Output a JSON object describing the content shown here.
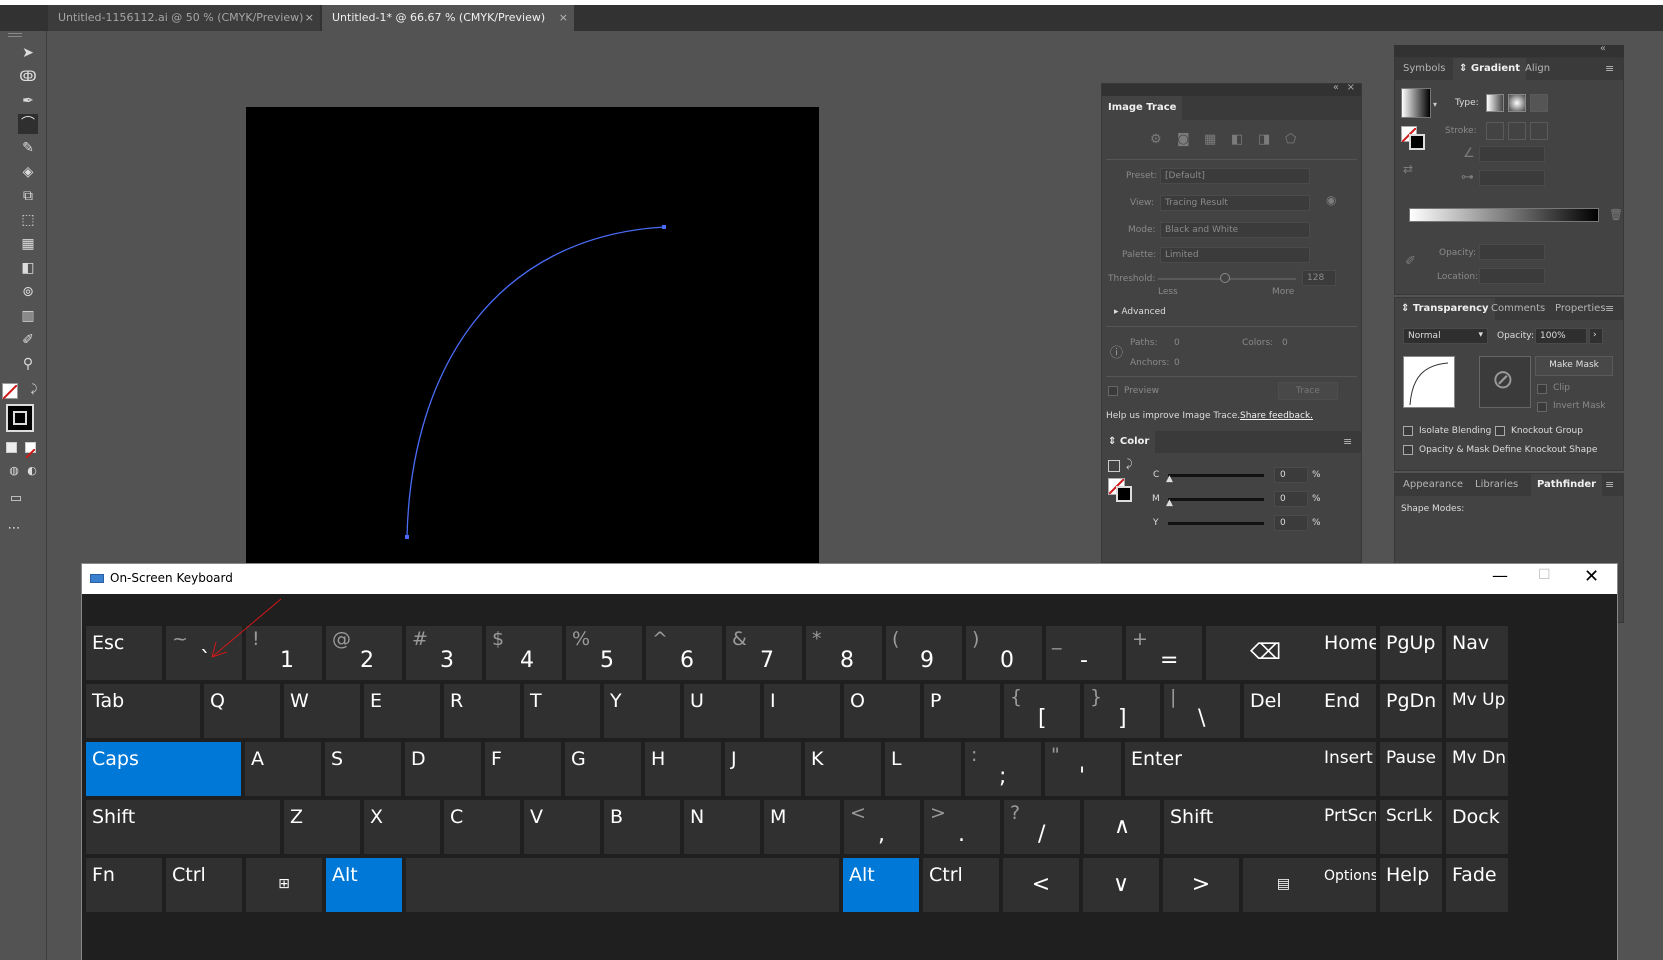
{
  "tabs": [
    {
      "label": "Untitled-1156112.ai @ 50 % (CMYK/Preview)",
      "close": "×"
    },
    {
      "label": "Untitled-1* @ 66.67 % (CMYK/Preview)",
      "close": "×"
    }
  ],
  "image_trace": {
    "title": "Image Trace",
    "preset_label": "Preset:",
    "preset_value": "[Default]",
    "view_label": "View:",
    "view_value": "Tracing Result",
    "mode_label": "Mode:",
    "mode_value": "Black and White",
    "palette_label": "Palette:",
    "palette_value": "Limited",
    "threshold_label": "Threshold:",
    "threshold_value": "128",
    "less": "Less",
    "more": "More",
    "advanced": "Advanced",
    "paths_label": "Paths:",
    "paths_value": "0",
    "colors_label": "Colors:",
    "colors_value": "0",
    "anchors_label": "Anchors:",
    "anchors_value": "0",
    "preview": "Preview",
    "trace_button": "Trace",
    "help_text": "Help us improve Image Trace.",
    "feedback_link": "Share feedback."
  },
  "color_panel": {
    "title": "Color",
    "c_label": "C",
    "c_value": "0",
    "m_label": "M",
    "m_value": "0",
    "y_label": "Y",
    "y_value": "0",
    "percent": "%"
  },
  "gradient_panel": {
    "tabs": [
      "Symbols",
      "Gradient",
      "Align"
    ],
    "type_label": "Type:",
    "stroke_label": "Stroke:",
    "opacity_label": "Opacity:",
    "location_label": "Location:"
  },
  "transparency_panel": {
    "tabs": [
      "Transparency",
      "Comments",
      "Properties"
    ],
    "blend_mode": "Normal",
    "opacity_label": "Opacity:",
    "opacity_value": "100%",
    "make_mask": "Make Mask",
    "clip": "Clip",
    "invert_mask": "Invert Mask",
    "isolate_blending": "Isolate Blending",
    "knockout_group": "Knockout Group",
    "opacity_mask": "Opacity & Mask Define Knockout Shape"
  },
  "pathfinder_panel": {
    "tabs": [
      "Appearance",
      "Libraries",
      "Pathfinder"
    ],
    "shape_modes": "Shape Modes:"
  },
  "osk": {
    "title": "On-Screen Keyboard",
    "rows": {
      "r1": [
        {
          "m": "Esc"
        },
        {
          "t": "~",
          "b": "`"
        },
        {
          "t": "!",
          "b": "1"
        },
        {
          "t": "@",
          "b": "2"
        },
        {
          "t": "#",
          "b": "3"
        },
        {
          "t": "$",
          "b": "4"
        },
        {
          "t": "%",
          "b": "5"
        },
        {
          "t": "^",
          "b": "6"
        },
        {
          "t": "&",
          "b": "7"
        },
        {
          "t": "*",
          "b": "8"
        },
        {
          "t": "(",
          "b": "9"
        },
        {
          "t": ")",
          "b": "0"
        },
        {
          "t": "_",
          "b": "-"
        },
        {
          "t": "+",
          "b": "="
        },
        {
          "m": "⌫"
        }
      ],
      "r2": [
        {
          "m": "Tab"
        },
        {
          "m": "Q"
        },
        {
          "m": "W"
        },
        {
          "m": "E"
        },
        {
          "m": "R"
        },
        {
          "m": "T"
        },
        {
          "m": "Y"
        },
        {
          "m": "U"
        },
        {
          "m": "I"
        },
        {
          "m": "O"
        },
        {
          "m": "P"
        },
        {
          "t": "{",
          "b": "["
        },
        {
          "t": "}",
          "b": "]"
        },
        {
          "t": "|",
          "b": "\\"
        },
        {
          "m": "Del"
        }
      ],
      "r3": [
        {
          "m": "Caps"
        },
        {
          "m": "A"
        },
        {
          "m": "S"
        },
        {
          "m": "D"
        },
        {
          "m": "F"
        },
        {
          "m": "G"
        },
        {
          "m": "H"
        },
        {
          "m": "J"
        },
        {
          "m": "K"
        },
        {
          "m": "L"
        },
        {
          "t": ":",
          "b": ";"
        },
        {
          "t": "\"",
          "b": "'"
        },
        {
          "m": "Enter"
        }
      ],
      "r4": [
        {
          "m": "Shift"
        },
        {
          "m": "Z"
        },
        {
          "m": "X"
        },
        {
          "m": "C"
        },
        {
          "m": "V"
        },
        {
          "m": "B"
        },
        {
          "m": "N"
        },
        {
          "m": "M"
        },
        {
          "t": "<",
          "b": ","
        },
        {
          "t": ">",
          "b": "."
        },
        {
          "t": "?",
          "b": "/"
        },
        {
          "m": "∧"
        },
        {
          "m": "Shift"
        }
      ],
      "r5": [
        {
          "m": "Fn"
        },
        {
          "m": "Ctrl"
        },
        {
          "m": "⊞"
        },
        {
          "m": "Alt"
        },
        {
          "m": ""
        },
        {
          "m": "Alt"
        },
        {
          "m": "Ctrl"
        },
        {
          "m": "<"
        },
        {
          "m": "∨"
        },
        {
          "m": ">"
        },
        {
          "m": "▤"
        }
      ]
    },
    "nav": [
      [
        "Home",
        "PgUp",
        "Nav"
      ],
      [
        "End",
        "PgDn",
        "Mv Up"
      ],
      [
        "Insert",
        "Pause",
        "Mv Dn"
      ],
      [
        "PrtScn",
        "ScrLk",
        "Dock"
      ],
      [
        "Options",
        "Help",
        "Fade"
      ]
    ]
  },
  "colors": {
    "accent": "#0078d7",
    "path": "#4a6cf7",
    "annotation": "#d01818"
  }
}
